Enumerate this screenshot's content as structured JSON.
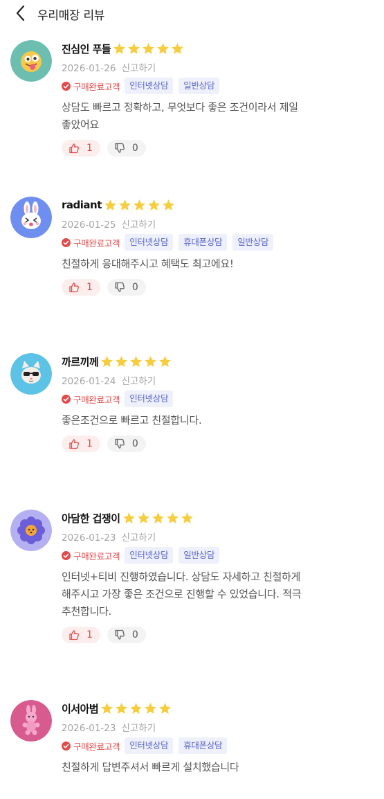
{
  "header": {
    "title": "우리매장 리뷰",
    "back_icon": "chevron-left-icon"
  },
  "colors": {
    "star": "#f5cd3f",
    "buyer_badge": "#e04b4b",
    "tag_bg": "#eef0fc",
    "tag_text": "#5966c8"
  },
  "reviews": [
    {
      "name": "진심인 푸들",
      "rating": 5,
      "date": "2026-01-26",
      "report": "신고하기",
      "buyer": "구매완료고객",
      "tags": [
        "인터넷상담",
        "일반상담"
      ],
      "text": "상담도 빠르고 정확하고, 무엇보다 좋은 조건이라서 제일\n좋았어요",
      "likes": "1",
      "dislikes": "0",
      "avatar_icon": "tongue-emoji-avatar",
      "avatar_bg": "#6cbfb0"
    },
    {
      "name": "radiant",
      "rating": 5,
      "date": "2026-01-25",
      "report": "신고하기",
      "buyer": "구매완료고객",
      "tags": [
        "인터넷상담",
        "휴대폰상담",
        "일반상담"
      ],
      "text": "친절하게 응대해주시고 혜택도 최고에요!",
      "likes": "1",
      "dislikes": "0",
      "avatar_icon": "rabbit-avatar",
      "avatar_bg": "#6e8ff0"
    },
    {
      "name": "까르끼께",
      "rating": 5,
      "date": "2026-01-24",
      "report": "신고하기",
      "buyer": "구매완료고객",
      "tags": [
        "인터넷상담"
      ],
      "text": "좋은조건으로 빠르고 친절합니다.",
      "likes": "1",
      "dislikes": "0",
      "avatar_icon": "cat-sunglasses-avatar",
      "avatar_bg": "#5cc2e6"
    },
    {
      "name": "아담한 겁쟁이",
      "rating": 5,
      "date": "2026-01-23",
      "report": "신고하기",
      "buyer": "구매완료고객",
      "tags": [
        "인터넷상담",
        "일반상담"
      ],
      "text": "인터넷+티비 진행하였습니다. 상담도 자세하고 친절하게\n해주시고 가장 좋은 조건으로 진행할 수 있었습니다. 적극\n추천합니다.",
      "likes": "1",
      "dislikes": "0",
      "avatar_icon": "flower-avatar",
      "avatar_bg": "#b4b0f2"
    },
    {
      "name": "이서아범",
      "rating": 5,
      "date": "2026-01-23",
      "report": "신고하기",
      "buyer": "구매완료고객",
      "tags": [
        "인터넷상담",
        "휴대폰상담"
      ],
      "text": "친절하게 답변주셔서 빠르게 설치했습니다",
      "likes": "",
      "dislikes": "",
      "avatar_icon": "pink-bunny-avatar",
      "avatar_bg": "#d85b8f"
    }
  ]
}
